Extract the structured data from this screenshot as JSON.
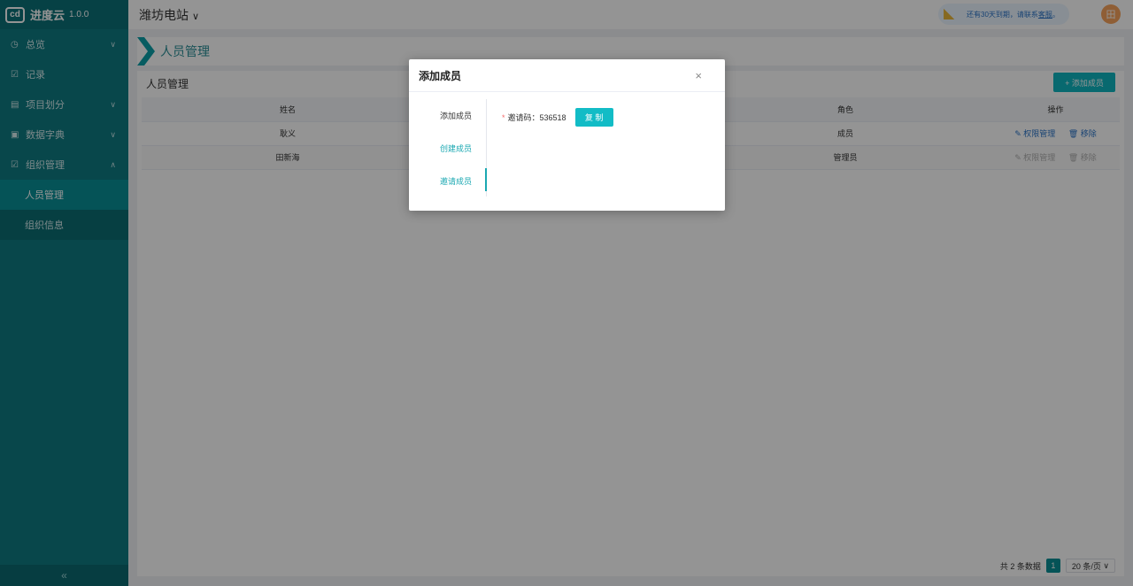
{
  "brand": {
    "logo": "cd",
    "name": "进度云",
    "version": "1.0.0"
  },
  "sidebar": {
    "items": [
      {
        "icon": "◷",
        "label": "总览",
        "expanded": false
      },
      {
        "icon": "☑",
        "label": "记录"
      },
      {
        "icon": "▤",
        "label": "项目划分",
        "expanded": false
      },
      {
        "icon": "▣",
        "label": "数据字典",
        "expanded": false
      },
      {
        "icon": "☑",
        "label": "组织管理",
        "expanded": true
      }
    ],
    "sub_items": [
      {
        "label": "人员管理",
        "active": true
      },
      {
        "label": "组织信息",
        "active": false
      }
    ],
    "collapse_icon": "«"
  },
  "topbar": {
    "site": "潍坊电站",
    "caret": "∨",
    "notice_text": "还有30天到期，请联系",
    "notice_link": "客服",
    "notice_end": "。",
    "avatar_text": "田"
  },
  "page": {
    "title": "人员管理"
  },
  "main": {
    "title": "人员管理",
    "add_button": "+ 添加成员",
    "columns": [
      "姓名",
      "",
      "角色",
      "操作"
    ],
    "rows": [
      {
        "name": "耿义",
        "role": "成员",
        "perm": "权限管理",
        "remove": "移除",
        "enabled": true
      },
      {
        "name": "田新海",
        "role": "管理员",
        "perm": "权限管理",
        "remove": "移除",
        "enabled": false
      }
    ],
    "pagination": {
      "total": "共 2 条数据",
      "page": "1",
      "page_size": "20 条/页"
    }
  },
  "modal": {
    "title": "添加成员",
    "close": "×",
    "tabs": [
      "添加成员",
      "创建成员",
      "邀请成员"
    ],
    "active_tab": 2,
    "invite_label": "邀请码：",
    "invite_code": "536518",
    "copy_button": "复 制"
  },
  "colors": {
    "sidebar": "#0e7b82",
    "accent": "#0fb6c0",
    "link": "#2b74c8"
  }
}
